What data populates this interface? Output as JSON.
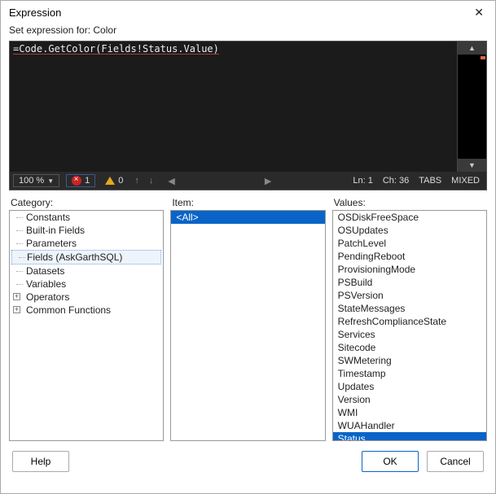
{
  "titlebar": {
    "title": "Expression"
  },
  "subtitle": "Set expression for: Color",
  "editor": {
    "code": "=Code.GetColor(Fields!Status.Value)",
    "zoom": "100 %",
    "error_count": "1",
    "warn_count": "0",
    "line": "Ln: 1",
    "col": "Ch: 36",
    "tabs": "TABS",
    "mixed": "MIXED"
  },
  "labels": {
    "category": "Category:",
    "item": "Item:",
    "values": "Values:"
  },
  "category_tree": {
    "leaf_items": [
      "Constants",
      "Built-in Fields",
      "Parameters",
      "Fields (AskGarthSQL)",
      "Datasets",
      "Variables"
    ],
    "expandable_items": [
      "Operators",
      "Common Functions"
    ],
    "selected": "Fields (AskGarthSQL)"
  },
  "item_list": {
    "items": [
      "<All>"
    ],
    "selected": "<All>"
  },
  "values_list": {
    "items": [
      "OSDiskFreeSpace",
      "OSUpdates",
      "PatchLevel",
      "PendingReboot",
      "ProvisioningMode",
      "PSBuild",
      "PSVersion",
      "StateMessages",
      "RefreshComplianceState",
      "Services",
      "Sitecode",
      "SWMetering",
      "Timestamp",
      "Updates",
      "Version",
      "WMI",
      "WUAHandler",
      "Status"
    ],
    "selected": "Status"
  },
  "buttons": {
    "help": "Help",
    "ok": "OK",
    "cancel": "Cancel"
  }
}
